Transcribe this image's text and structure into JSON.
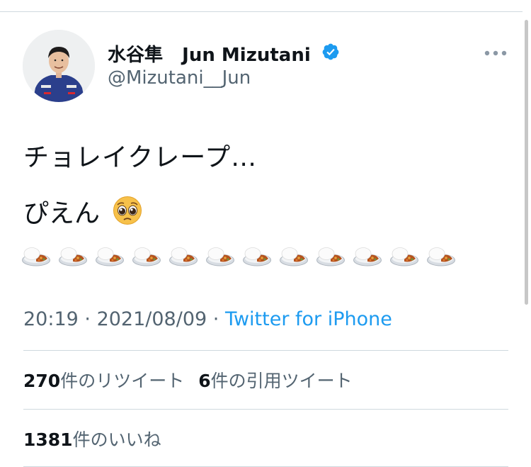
{
  "user": {
    "name_jp": "水谷隼",
    "name_en": "Jun Mizutani",
    "handle": "@Mizutani__Jun",
    "verified": true,
    "verified_color": "#1d9bf0"
  },
  "menu": {
    "icon": "more-icon"
  },
  "tweet": {
    "line1": "チョレイクレープ…",
    "line2": "ぴえん",
    "line2_emoji": "pleading-face-icon",
    "emoji_row": {
      "icon": "curry-rice-icon",
      "count": 12
    }
  },
  "meta": {
    "time": "20:19",
    "sep1": " · ",
    "date": "2021/08/09",
    "sep2": " · ",
    "source": "Twitter for iPhone",
    "source_color": "#1d9bf0"
  },
  "stats": {
    "retweets": {
      "count": "270",
      "label": "件のリツイート"
    },
    "quotes": {
      "count": "6",
      "label": "件の引用ツイート"
    },
    "likes": {
      "count": "1381",
      "label": "件のいいね"
    }
  }
}
